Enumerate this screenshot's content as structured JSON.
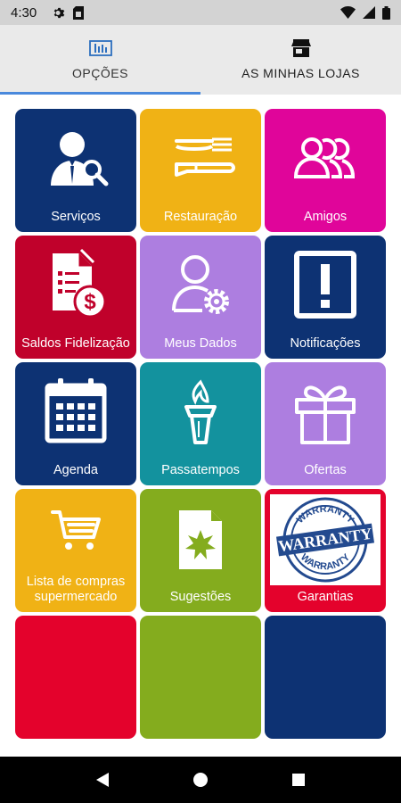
{
  "status_bar": {
    "time": "4:30",
    "icons": [
      "gear-icon",
      "sim-card-icon",
      "wifi-icon",
      "signal-icon",
      "battery-icon"
    ]
  },
  "tabs": [
    {
      "label": "OPÇÕES",
      "icon": "equalizer-icon",
      "active": true
    },
    {
      "label": "AS MINHAS LOJAS",
      "icon": "store-icon",
      "active": false
    }
  ],
  "tiles": [
    {
      "label": "Serviços",
      "color": "#0d3273",
      "icon": "person-search-icon"
    },
    {
      "label": "Restauração",
      "color": "#f0b215",
      "icon": "cutlery-icon"
    },
    {
      "label": "Amigos",
      "color": "#e0059a",
      "icon": "group-icon"
    },
    {
      "label": "Saldos Fidelização",
      "color": "#c0012b",
      "icon": "document-money-icon"
    },
    {
      "label": "Meus Dados",
      "color": "#ad7ee0",
      "icon": "user-gear-icon"
    },
    {
      "label": "Notificações",
      "color": "#0d3273",
      "icon": "exclamation-icon"
    },
    {
      "label": "Agenda",
      "color": "#0d3273",
      "icon": "calendar-icon"
    },
    {
      "label": "Passatempos",
      "color": "#13929e",
      "icon": "torch-icon"
    },
    {
      "label": "Ofertas",
      "color": "#ad7ee0",
      "icon": "gift-icon"
    },
    {
      "label": "Lista de compras supermercado",
      "color": "#f0b215",
      "icon": "cart-icon"
    },
    {
      "label": "Sugestões",
      "color": "#84ac1e",
      "icon": "document-star-icon"
    },
    {
      "label": "Garantias",
      "color": "#e4022c",
      "icon": "warranty-stamp-icon"
    },
    {
      "label": "",
      "color": "#e4022c",
      "icon": ""
    },
    {
      "label": "",
      "color": "#84ac1e",
      "icon": ""
    },
    {
      "label": "",
      "color": "#0d3273",
      "icon": ""
    }
  ],
  "warranty_stamp_text": "WARRANTY",
  "nav_bar": {
    "buttons": [
      "back-icon",
      "home-icon",
      "recents-icon"
    ]
  }
}
